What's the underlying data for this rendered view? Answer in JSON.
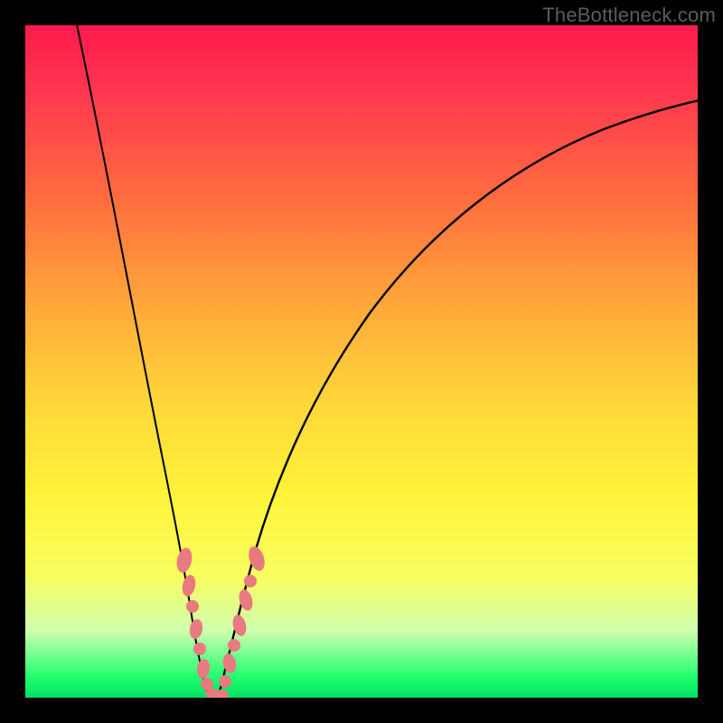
{
  "attribution": "TheBottleneck.com",
  "chart_data": {
    "type": "line",
    "title": "",
    "xlabel": "",
    "ylabel": "",
    "xlim": [
      0,
      100
    ],
    "ylim": [
      0,
      100
    ],
    "series": [
      {
        "name": "bottleneck-curve",
        "x": [
          0,
          5,
          10,
          13,
          16,
          19,
          22,
          24,
          25,
          26,
          27,
          28,
          30,
          33,
          37,
          42,
          50,
          60,
          72,
          85,
          100
        ],
        "y": [
          100,
          85,
          68,
          56,
          44,
          32,
          18,
          8,
          3,
          0,
          0,
          3,
          10,
          22,
          36,
          48,
          62,
          72,
          80,
          86,
          90
        ]
      }
    ],
    "annotations": {
      "nodules_left": [
        {
          "x": 21.5,
          "y": 22
        },
        {
          "x": 22.3,
          "y": 18
        },
        {
          "x": 22.7,
          "y": 15
        },
        {
          "x": 23.1,
          "y": 12
        },
        {
          "x": 23.7,
          "y": 9
        },
        {
          "x": 24.4,
          "y": 5
        },
        {
          "x": 25.2,
          "y": 2
        }
      ],
      "nodules_bottom": [
        {
          "x": 25.8,
          "y": 0.5
        },
        {
          "x": 26.6,
          "y": 0.3
        },
        {
          "x": 27.4,
          "y": 0.5
        }
      ],
      "nodules_right": [
        {
          "x": 28.2,
          "y": 3
        },
        {
          "x": 28.9,
          "y": 7
        },
        {
          "x": 29.7,
          "y": 11
        },
        {
          "x": 30.5,
          "y": 15
        },
        {
          "x": 31.0,
          "y": 18
        },
        {
          "x": 31.8,
          "y": 22
        }
      ]
    }
  },
  "colors": {
    "nodule": "#e97a7f",
    "curve": "#000000"
  }
}
